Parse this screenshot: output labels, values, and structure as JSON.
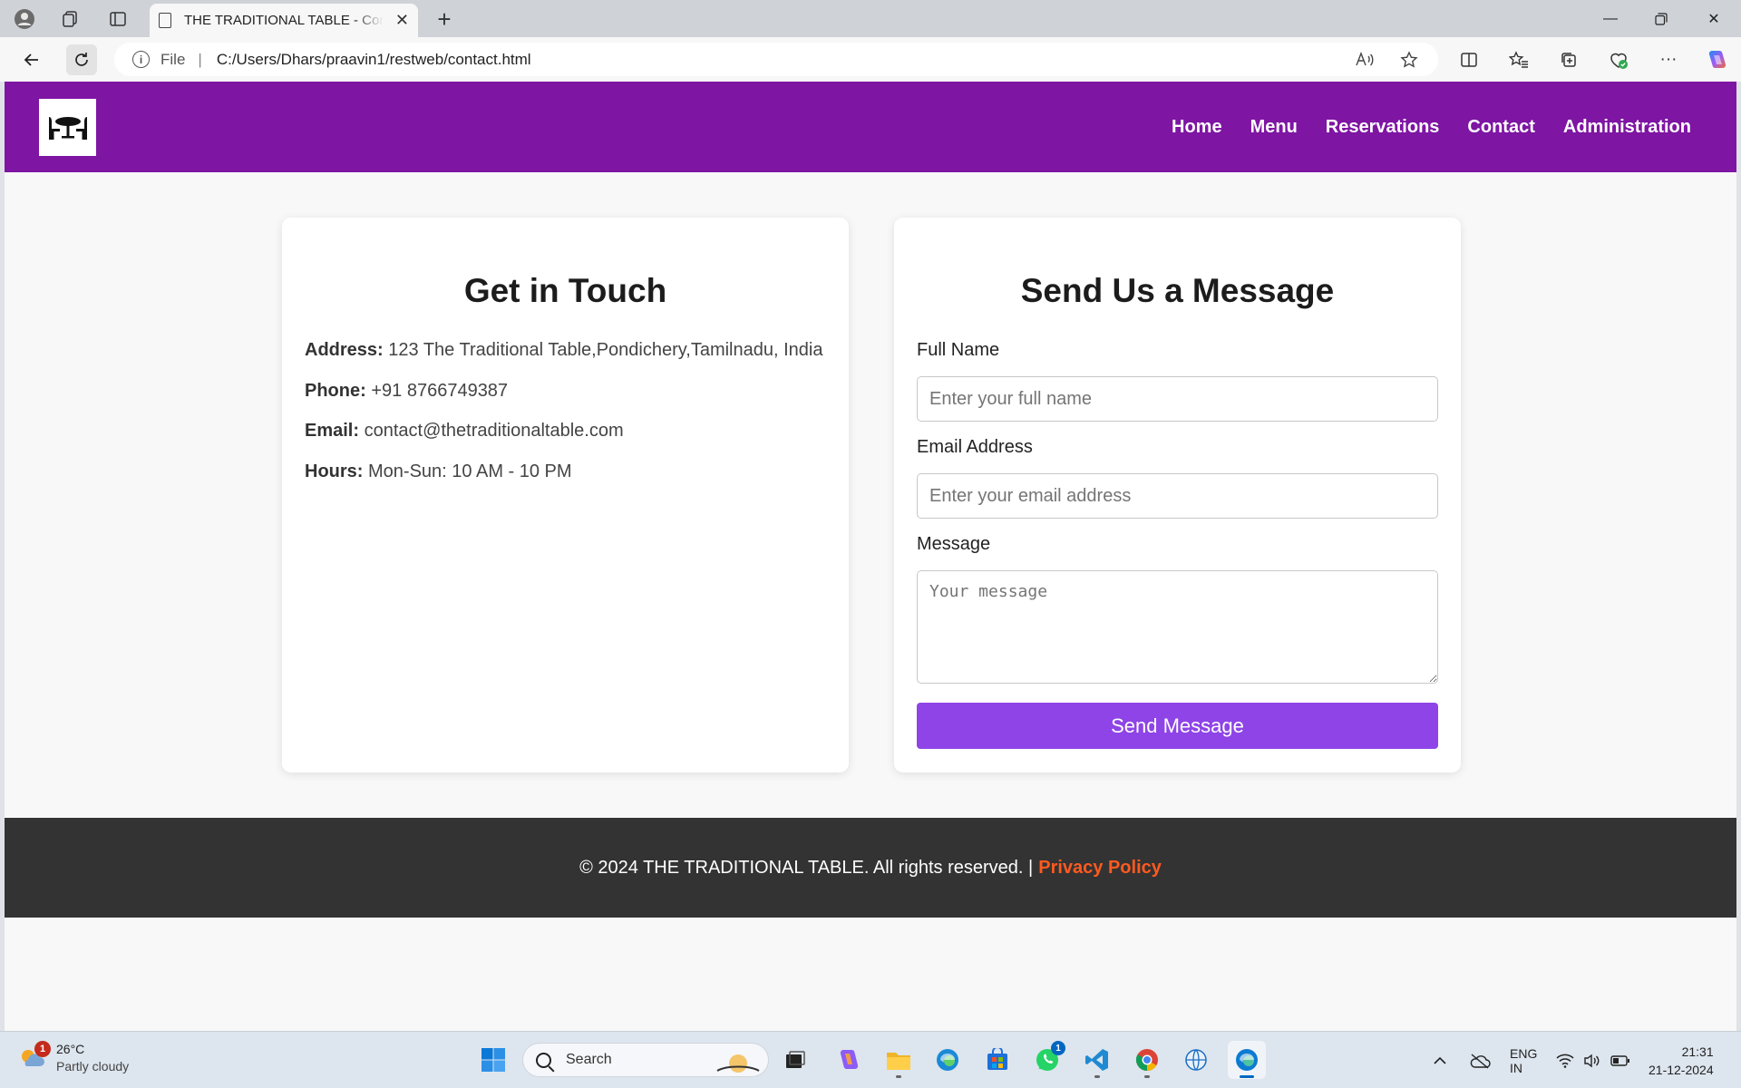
{
  "browser": {
    "tab_title": "THE TRADITIONAL TABLE - Contact",
    "url_scheme_label": "File",
    "url": "C:/Users/Dhars/praavin1/restweb/contact.html"
  },
  "site": {
    "nav": [
      "Home",
      "Menu",
      "Reservations",
      "Contact",
      "Administration"
    ],
    "contact": {
      "title": "Get in Touch",
      "address_label": "Address:",
      "address": "123 The Traditional Table,Pondichery,Tamilnadu, India",
      "phone_label": "Phone:",
      "phone": "+91 8766749387",
      "email_label": "Email:",
      "email": "contact@thetraditionaltable.com",
      "hours_label": "Hours:",
      "hours": "Mon-Sun: 10 AM - 10 PM"
    },
    "form": {
      "title": "Send Us a Message",
      "name_label": "Full Name",
      "name_placeholder": "Enter your full name",
      "email_label": "Email Address",
      "email_placeholder": "Enter your email address",
      "message_label": "Message",
      "message_placeholder": "Your message",
      "submit": "Send Message"
    },
    "footer": {
      "copyright": "© 2024 THE TRADITIONAL TABLE. All rights reserved. |",
      "policy_link": "Privacy Policy"
    },
    "colors": {
      "header_bg": "#7e15a3",
      "button_bg": "#8e44e6",
      "footer_bg": "#333333",
      "policy_link": "#ff5a1f"
    }
  },
  "taskbar": {
    "weather_temp": "26°C",
    "weather_condition": "Partly cloudy",
    "weather_badge": "1",
    "search_placeholder": "Search",
    "whatsapp_badge": "1",
    "lang_top": "ENG",
    "lang_bottom": "IN",
    "time": "21:31",
    "date": "21-12-2024"
  }
}
